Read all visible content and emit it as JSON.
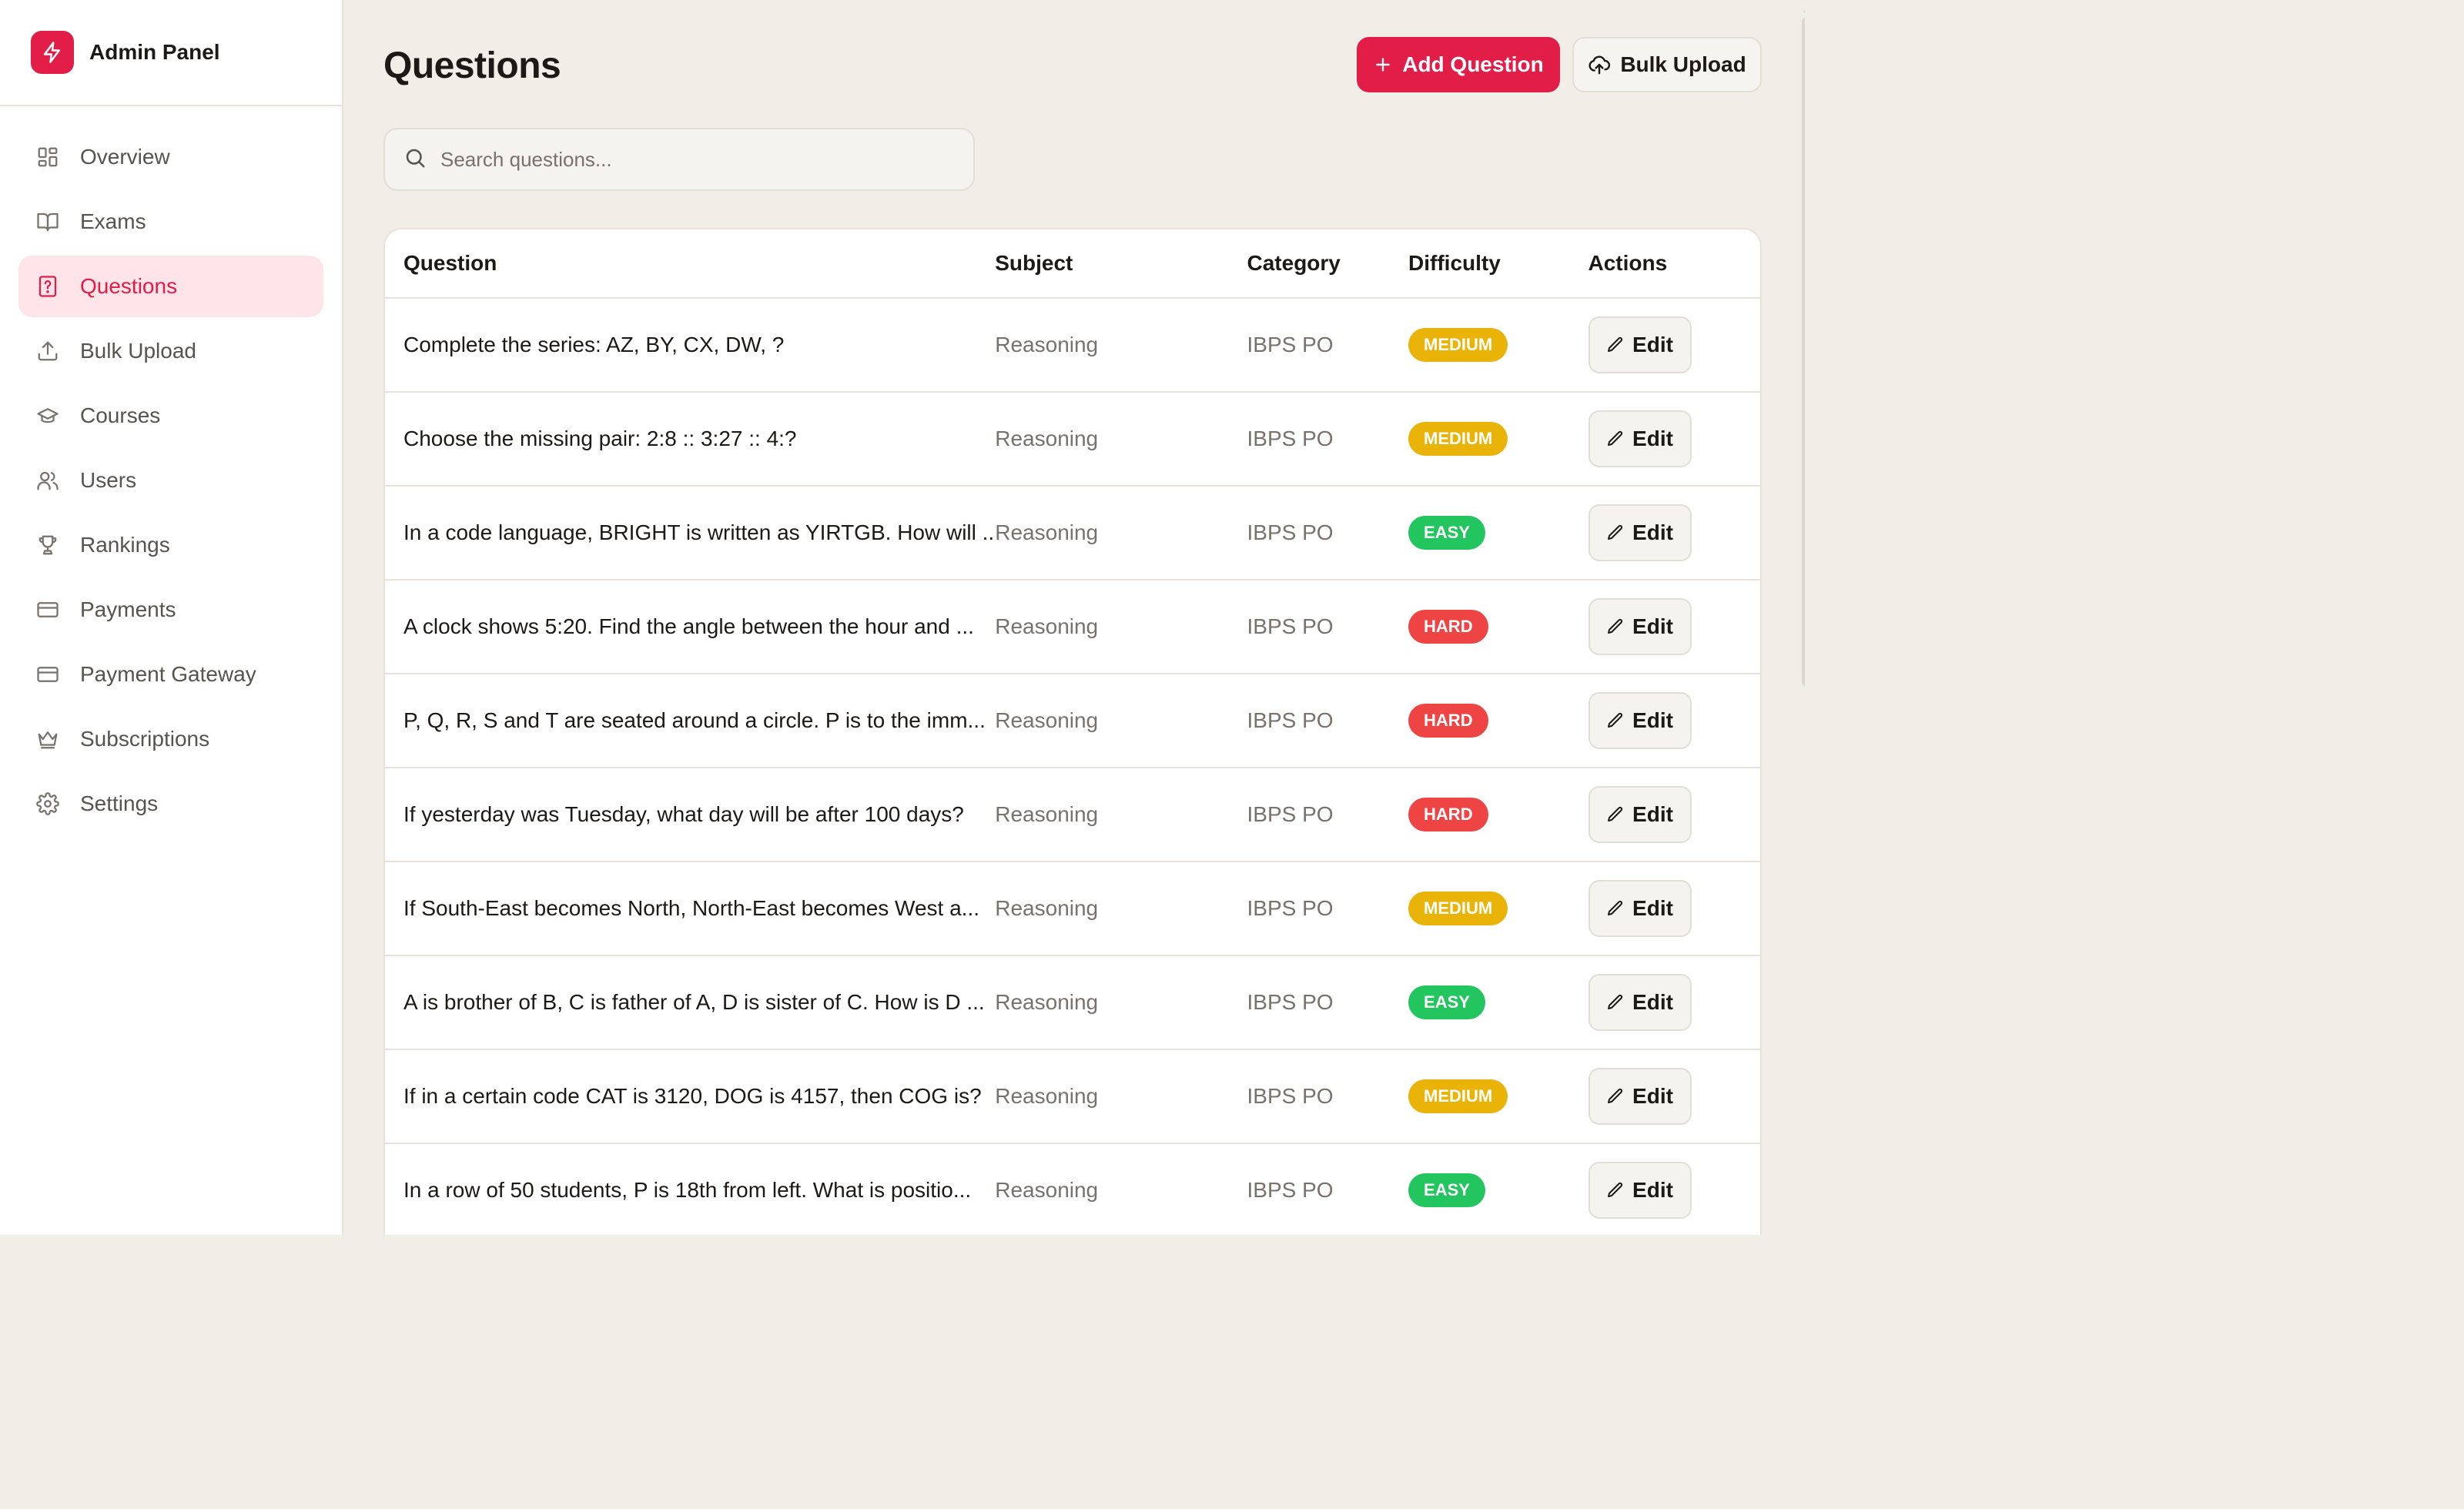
{
  "sidebar": {
    "brand_name": "Admin Panel",
    "brand_icon": "lightning-icon",
    "items": [
      {
        "label": "Overview",
        "icon": "grid-icon",
        "active": false
      },
      {
        "label": "Exams",
        "icon": "book-icon",
        "active": false
      },
      {
        "label": "Questions",
        "icon": "question-file-icon",
        "active": true
      },
      {
        "label": "Bulk Upload",
        "icon": "upload-icon",
        "active": false
      },
      {
        "label": "Courses",
        "icon": "graduation-cap-icon",
        "active": false
      },
      {
        "label": "Users",
        "icon": "users-icon",
        "active": false
      },
      {
        "label": "Rankings",
        "icon": "trophy-icon",
        "active": false
      },
      {
        "label": "Payments",
        "icon": "credit-card-icon",
        "active": false
      },
      {
        "label": "Payment Gateway",
        "icon": "credit-card-icon",
        "active": false
      },
      {
        "label": "Subscriptions",
        "icon": "crown-icon",
        "active": false
      },
      {
        "label": "Settings",
        "icon": "gear-icon",
        "active": false
      }
    ]
  },
  "header": {
    "title": "Questions",
    "add_label": "Add Question",
    "bulk_label": "Bulk Upload"
  },
  "search": {
    "placeholder": "Search questions...",
    "value": ""
  },
  "table": {
    "columns": [
      "Question",
      "Subject",
      "Category",
      "Difficulty",
      "Actions"
    ],
    "edit_label": "Edit",
    "rows": [
      {
        "question": "Complete the series: AZ, BY, CX, DW, ?",
        "subject": "Reasoning",
        "category": "IBPS PO",
        "difficulty": "MEDIUM"
      },
      {
        "question": "Choose the missing pair: 2:8 :: 3:27 :: 4:?",
        "subject": "Reasoning",
        "category": "IBPS PO",
        "difficulty": "MEDIUM"
      },
      {
        "question": "In a code language, BRIGHT is written as YIRTGB. How will ...",
        "subject": "Reasoning",
        "category": "IBPS PO",
        "difficulty": "EASY"
      },
      {
        "question": "A clock shows 5:20. Find the angle between the hour and ...",
        "subject": "Reasoning",
        "category": "IBPS PO",
        "difficulty": "HARD"
      },
      {
        "question": "P, Q, R, S and T are seated around a circle. P is to the imm...",
        "subject": "Reasoning",
        "category": "IBPS PO",
        "difficulty": "HARD"
      },
      {
        "question": "If yesterday was Tuesday, what day will be after 100 days?",
        "subject": "Reasoning",
        "category": "IBPS PO",
        "difficulty": "HARD"
      },
      {
        "question": "If South-East becomes North, North-East becomes West a...",
        "subject": "Reasoning",
        "category": "IBPS PO",
        "difficulty": "MEDIUM"
      },
      {
        "question": "A is brother of B, C is father of A, D is sister of C. How is D ...",
        "subject": "Reasoning",
        "category": "IBPS PO",
        "difficulty": "EASY"
      },
      {
        "question": "If in a certain code CAT is 3120, DOG is 4157, then COG is?",
        "subject": "Reasoning",
        "category": "IBPS PO",
        "difficulty": "MEDIUM"
      },
      {
        "question": "In a row of 50 students, P is 18th from left. What is positio...",
        "subject": "Reasoning",
        "category": "IBPS PO",
        "difficulty": "EASY"
      }
    ]
  },
  "colors": {
    "accent": "#e11d48",
    "medium": "#eab308",
    "easy": "#22c55e",
    "hard": "#ef4444",
    "background": "#f1eee8"
  }
}
